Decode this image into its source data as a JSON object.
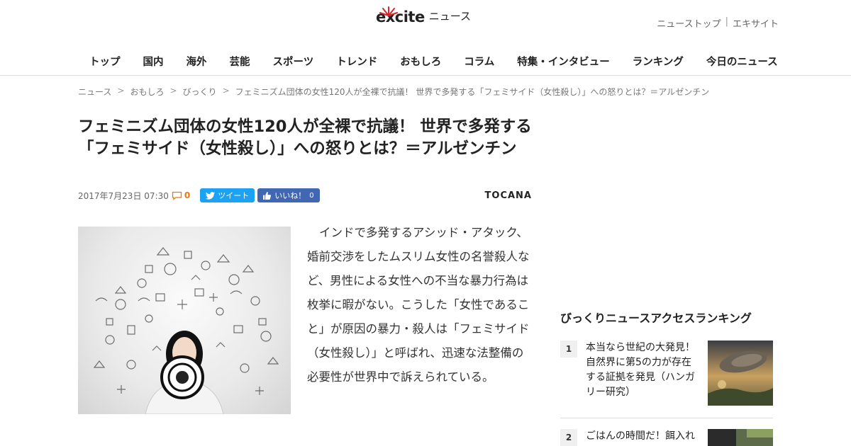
{
  "header": {
    "logo_brand": "excite",
    "logo_news": "ニュース",
    "top_links": [
      "ニューストップ",
      "エキサイト"
    ],
    "nav": [
      "トップ",
      "国内",
      "海外",
      "芸能",
      "スポーツ",
      "トレンド",
      "おもしろ",
      "コラム",
      "特集・インタビュー",
      "ランキング",
      "今日のニュース"
    ]
  },
  "breadcrumb": [
    "ニュース",
    "おもしろ",
    "びっくり",
    "フェミニズム団体の女性120人が全裸で抗議！ 世界で多発する「フェミサイド（女性殺し）」への怒りとは？＝アルゼンチン"
  ],
  "article": {
    "title": "フェミニズム団体の女性120人が全裸で抗議！ 世界で多発する「フェミサイド（女性殺し）」への怒りとは？＝アルゼンチン",
    "date": "2017年7月23日 07:30",
    "comment_count": "0",
    "tweet_label": "ツイート",
    "like_label": "いいね！",
    "like_count": "0",
    "source": "TOCANA",
    "body": "インドで多発するアシッド・アタック、婚前交渉をしたムスリム女性の名誉殺人など、男性による女性への不当な暴力行為は枚挙に暇がない。こうした「女性であること」が原因の暴力・殺人は「フェミサイド（女性殺し）」と呼ばれ、迅速な法整備の必要性が世界中で訴えられている。"
  },
  "sidebar": {
    "ranking_title": "びっくりニュースアクセスランキング",
    "items": [
      {
        "rank": "1",
        "text": "本当なら世紀の大発見！自然界に第5の力が存在する証拠を発見（ハンガリー研究）"
      },
      {
        "rank": "2",
        "text": "ごはんの時間だ！餌入れ"
      }
    ]
  },
  "colors": {
    "tweet": "#1da1f2",
    "like": "#4267b2",
    "comment_accent": "#e8780f",
    "logo_spark": "#d7262c"
  }
}
